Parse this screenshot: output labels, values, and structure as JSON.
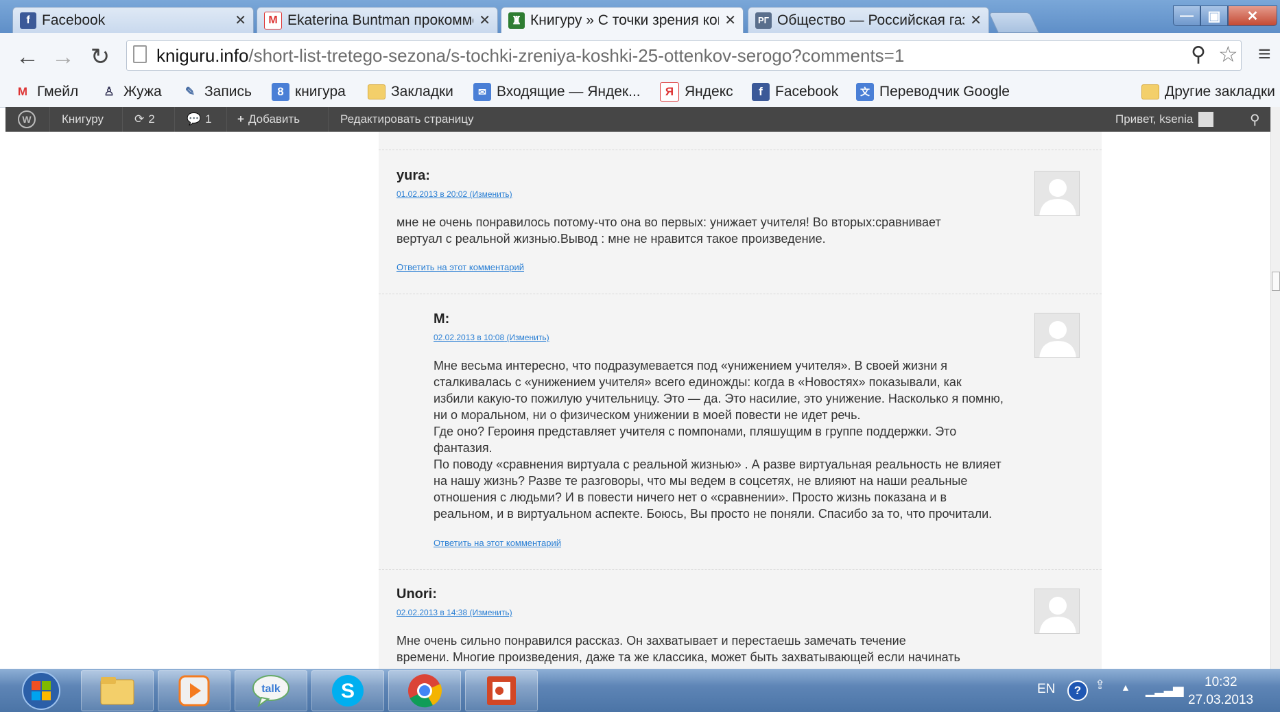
{
  "browser": {
    "tabs": [
      {
        "label": "Facebook",
        "icon": "facebook-icon"
      },
      {
        "label": "Ekaterina Buntman прокомментировал",
        "icon": "gmail-icon"
      },
      {
        "label": "Книгуру » С точки зрения кошки",
        "icon": "kniguru-icon"
      },
      {
        "label": "Общество — Российская газета",
        "icon": "rg-icon"
      }
    ],
    "window_buttons": {
      "minimize": "—",
      "restore": "▣",
      "close": "✕"
    },
    "url_host": "kniguru.info",
    "url_path": "/short-list-tretego-sezona/s-tochki-zreniya-koshki-25-ottenkov-serogo?comments=1"
  },
  "bookmarks": [
    {
      "label": "Гмейл",
      "icon": "gmail-icon"
    },
    {
      "label": "Жужа",
      "icon": "person-icon"
    },
    {
      "label": "Запись",
      "icon": "pencil-icon"
    },
    {
      "label": "книгура",
      "icon": "kniguru-bookmark-icon"
    },
    {
      "label": "Закладки",
      "icon": "folder-icon"
    },
    {
      "label": "Входящие — Яндек...",
      "icon": "mail-icon"
    },
    {
      "label": "Яндекс",
      "icon": "yandex-icon"
    },
    {
      "label": "Facebook",
      "icon": "facebook-icon"
    },
    {
      "label": "Переводчик Google",
      "icon": "google-translate-icon"
    }
  ],
  "other_bookmarks": "Другие закладки",
  "adminbar": {
    "site": "Книгуру",
    "updates": "2",
    "comments": "1",
    "add": "Добавить",
    "edit": "Редактировать страницу",
    "greeting": "Привет, ksenia"
  },
  "comments": [
    {
      "author": "yura",
      "date": "01.02.2013 в 20:02",
      "edit": "(Изменить)",
      "lines": [
        "мне не очень понравилось потому-что она во первых: унижает учителя! Во вторых:сравнивает",
        "вертуал с реальной жизнью.Вывод : мне не нравится такое произведение."
      ],
      "reply": "Ответить на этот комментарий"
    },
    {
      "author": "M",
      "date": "02.02.2013 в 10:08",
      "edit": "(Изменить)",
      "lines": [
        "Мне весьма интересно, что подразумевается под «унижением учителя». В своей жизни я",
        "сталкивалась с «унижением учителя» всего единожды: когда в «Новостях» показывали, как",
        "избили какую-то пожилую учительницу. Это — да. Это насилие, это унижение. Насколько я помню,",
        "ни о моральном, ни о физическом унижении в моей повести не идет речь.",
        "Где оно? Героиня представляет учителя с помпонами, пляшущим в группе поддержки. Это",
        "фантазия.",
        "По поводу «сравнения виртуала с реальной жизнью» . А разве виртуальная реальность не влияет",
        "на нашу жизнь? Разве те разговоры, что мы ведем в соцсетях, не влияют на наши реальные",
        "отношения с людьми? И в повести ничего нет о «сравнении». Просто жизнь показана и в",
        "реальном, и в виртуальном аспекте. Боюсь, Вы просто не поняли. Спасибо за то, что прочитали."
      ],
      "reply": "Ответить на этот комментарий"
    },
    {
      "author": "Unori",
      "date": "02.02.2013 в 14:38",
      "edit": "(Изменить)",
      "lines": [
        "Мне очень сильно понравился рассказ. Он захватывает и перестаешь замечать течение",
        "времени. Многие произведения, даже та же классика, может быть захватывающей если начинать"
      ]
    }
  ],
  "taskbar": {
    "lang": "EN",
    "time": "10:32",
    "date": "27.03.2013",
    "apps": [
      "windows-start-icon",
      "explorer-icon",
      "media-player-icon",
      "google-talk-icon",
      "skype-icon",
      "chrome-icon",
      "presentation-icon"
    ]
  },
  "colors": {
    "link": "#2a7fd4",
    "adminbar": "#464646",
    "content_bg": "#f4f4f4"
  }
}
